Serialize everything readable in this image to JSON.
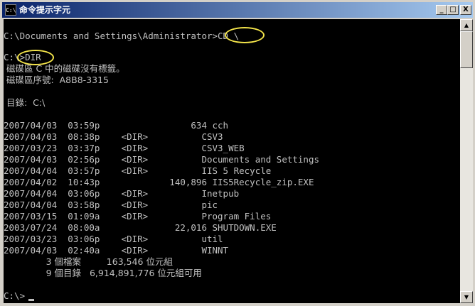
{
  "window": {
    "title": "命令提示字元",
    "icon_label": "C:\\",
    "buttons": {
      "minimize": "_",
      "maximize": "□",
      "close": "X"
    }
  },
  "console": {
    "lines": [
      "",
      "C:\\Documents and Settings\\Administrator>CD \\",
      "",
      "C:\\>DIR",
      " 磁碟區 C 中的磁碟沒有標籤。",
      " 磁碟區序號:  A8B8-3315",
      "",
      " 目錄:  C:\\",
      "",
      "2007/04/03  03:59p                 634 cch",
      "2007/04/03  08:38p    <DIR>          CSV3",
      "2007/03/23  03:37p    <DIR>          CSV3_WEB",
      "2007/04/03  02:56p    <DIR>          Documents and Settings",
      "2007/04/04  03:57p    <DIR>          IIS 5 Recycle",
      "2007/04/02  10:43p             140,896 IIS5Recycle_zip.EXE",
      "2007/04/04  03:06p    <DIR>          Inetpub",
      "2007/04/04  03:58p    <DIR>          pic",
      "2007/03/15  01:09a    <DIR>          Program Files",
      "2003/07/24  08:00a              22,016 SHUTDOWN.EXE",
      "2007/03/23  03:06p    <DIR>          util",
      "2007/04/03  02:40a    <DIR>          WINNT",
      "               3 個檔案         163,546 位元組",
      "               9 個目錄   6,914,891,776 位元組可用",
      "",
      "C:\\>"
    ]
  },
  "highlight_color": "#f3e44a",
  "scrollbar": {
    "up_arrow": "▲",
    "down_arrow": "▼"
  }
}
